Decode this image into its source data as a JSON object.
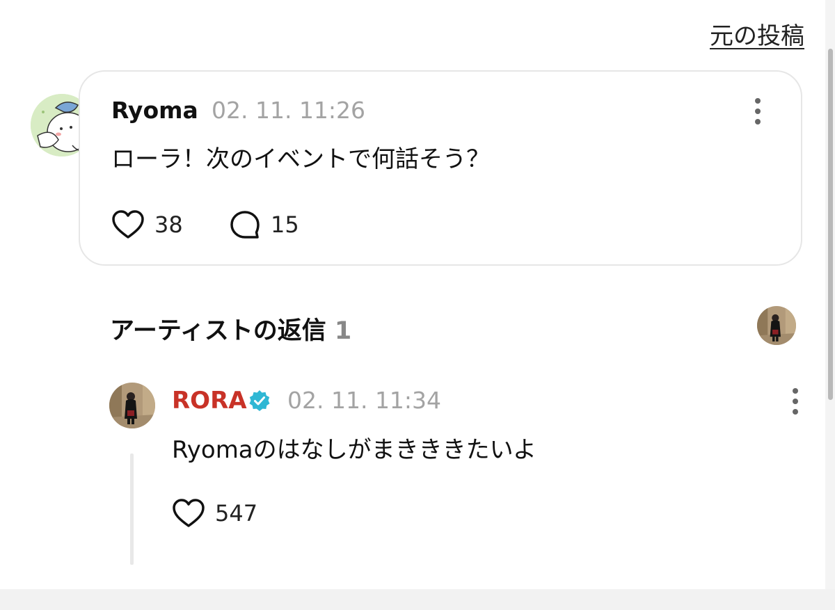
{
  "header": {
    "original_post_link": "元の投稿"
  },
  "post": {
    "author": "Ryoma",
    "timestamp": "02. 11. 11:26",
    "text": "ローラ！次のイベントで何話そう？",
    "likes": "38",
    "comments": "15"
  },
  "artist_replies": {
    "heading": "アーティストの返信",
    "count": "1"
  },
  "reply": {
    "author": "RORA",
    "timestamp": "02. 11. 11:34",
    "text": "Ryomaのはなしがまきききたいよ",
    "likes": "547"
  },
  "colors": {
    "artist_name": "#c83227",
    "verified_badge": "#2fb7d4",
    "muted_text": "#a3a3a3"
  },
  "icons": [
    "heart-icon",
    "comment-bubble-icon",
    "more-vertical-icon",
    "verified-badge-icon"
  ]
}
